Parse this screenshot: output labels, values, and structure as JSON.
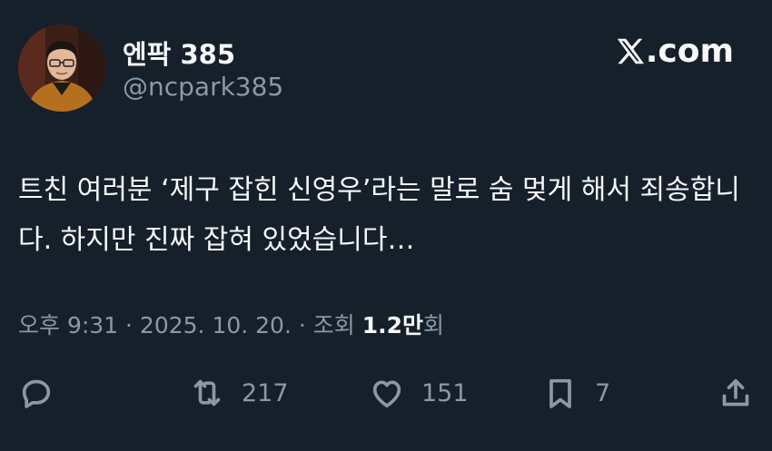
{
  "author": {
    "display_name": "엔팍 385",
    "handle": "@ncpark385"
  },
  "brand": {
    "label": ".com",
    "logo": "x-logo-icon"
  },
  "tweet": {
    "text": "트친 여러분 ‘제구 잡힌 신영우’라는 말로 숨 멎게 해서 죄송합니다. 하지만 진짜 잡혀 있었습니다…",
    "timestamp": "오후 9:31 · 2025. 10. 20. · 조회 ",
    "views_number": "1.2만",
    "views_suffix": "회"
  },
  "actions": {
    "reply_icon": "reply-icon",
    "retweet_count": "217",
    "like_count": "151",
    "bookmark_count": "7",
    "share_icon": "share-icon"
  },
  "colors": {
    "background": "#15202b",
    "text": "#f7f9f9",
    "muted": "#8b98a5"
  }
}
